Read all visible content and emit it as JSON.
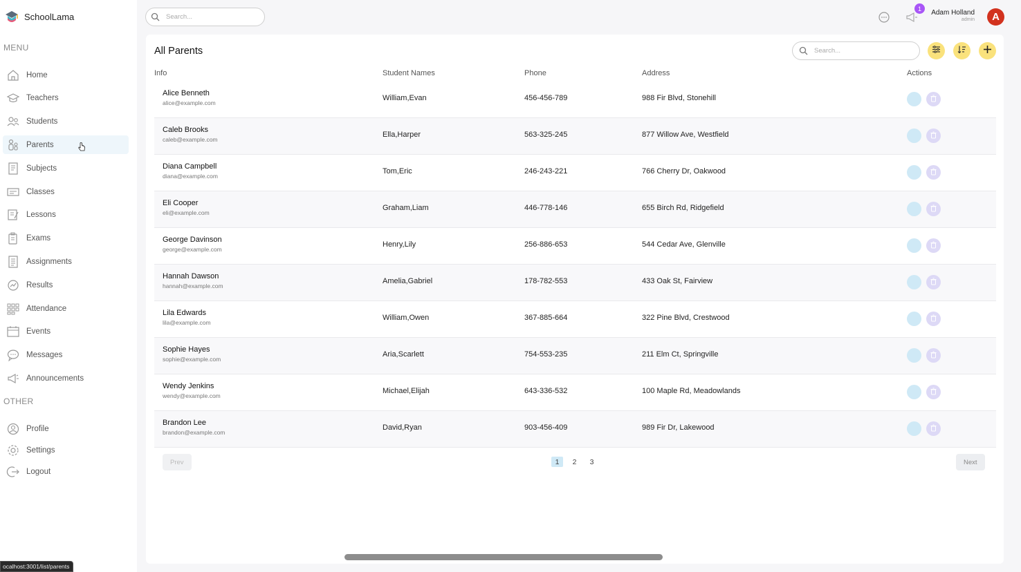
{
  "app": {
    "name": "SchoolLama"
  },
  "sidebar": {
    "menu_heading": "MENU",
    "other_heading": "OTHER",
    "menu_items": [
      {
        "label": "Home",
        "icon": "home-icon"
      },
      {
        "label": "Teachers",
        "icon": "teacher-icon"
      },
      {
        "label": "Students",
        "icon": "student-icon"
      },
      {
        "label": "Parents",
        "icon": "parent-icon",
        "active": true
      },
      {
        "label": "Subjects",
        "icon": "subject-icon"
      },
      {
        "label": "Classes",
        "icon": "class-icon"
      },
      {
        "label": "Lessons",
        "icon": "lesson-icon"
      },
      {
        "label": "Exams",
        "icon": "exam-icon"
      },
      {
        "label": "Assignments",
        "icon": "assignment-icon"
      },
      {
        "label": "Results",
        "icon": "result-icon"
      },
      {
        "label": "Attendance",
        "icon": "attendance-icon"
      },
      {
        "label": "Events",
        "icon": "calendar-icon"
      },
      {
        "label": "Messages",
        "icon": "message-icon"
      },
      {
        "label": "Announcements",
        "icon": "announcement-icon"
      }
    ],
    "other_items": [
      {
        "label": "Profile",
        "icon": "profile-icon"
      },
      {
        "label": "Settings",
        "icon": "settings-icon"
      },
      {
        "label": "Logout",
        "icon": "logout-icon"
      }
    ]
  },
  "topbar": {
    "search_placeholder": "Search...",
    "notification_count": "1",
    "user_name": "Adam Holland",
    "user_role": "admin",
    "avatar_letter": "A"
  },
  "panel": {
    "title": "All Parents",
    "search_placeholder": "Search...",
    "columns": [
      "Info",
      "Student Names",
      "Phone",
      "Address",
      "Actions"
    ],
    "rows": [
      {
        "name": "Alice Benneth",
        "email": "alice@example.com",
        "students": "William,Evan",
        "phone": "456-456-789",
        "address": "988 Fir Blvd, Stonehill"
      },
      {
        "name": "Caleb Brooks",
        "email": "caleb@example.com",
        "students": "Ella,Harper",
        "phone": "563-325-245",
        "address": "877 Willow Ave, Westfield"
      },
      {
        "name": "Diana Campbell",
        "email": "diana@example.com",
        "students": "Tom,Eric",
        "phone": "246-243-221",
        "address": "766 Cherry Dr, Oakwood"
      },
      {
        "name": "Eli Cooper",
        "email": "eli@example.com",
        "students": "Graham,Liam",
        "phone": "446-778-146",
        "address": "655 Birch Rd, Ridgefield"
      },
      {
        "name": "George Davinson",
        "email": "george@example.com",
        "students": "Henry,Lily",
        "phone": "256-886-653",
        "address": "544 Cedar Ave, Glenville"
      },
      {
        "name": "Hannah Dawson",
        "email": "hannah@example.com",
        "students": "Amelia,Gabriel",
        "phone": "178-782-553",
        "address": "433 Oak St, Fairview"
      },
      {
        "name": "Lila Edwards",
        "email": "lila@example.com",
        "students": "William,Owen",
        "phone": "367-885-664",
        "address": "322 Pine Blvd, Crestwood"
      },
      {
        "name": "Sophie Hayes",
        "email": "sophie@example.com",
        "students": "Aria,Scarlett",
        "phone": "754-553-235",
        "address": "211 Elm Ct, Springville"
      },
      {
        "name": "Wendy Jenkins",
        "email": "wendy@example.com",
        "students": "Michael,Elijah",
        "phone": "643-336-532",
        "address": "100 Maple Rd, Meadowlands"
      },
      {
        "name": "Brandon Lee",
        "email": "brandon@example.com",
        "students": "David,Ryan",
        "phone": "903-456-409",
        "address": "989 Fir Dr, Lakewood"
      }
    ],
    "pagination": {
      "prev_label": "Prev",
      "next_label": "Next",
      "pages": [
        "1",
        "2",
        "3"
      ],
      "current": "1"
    }
  },
  "status_bar": {
    "url": "ocalhost:3001/list/parents"
  },
  "colors": {
    "accent_yellow": "#fae27c",
    "sky_light": "#cfe9f6",
    "purple_light": "#ddd9f6",
    "badge_purple": "#a855f7",
    "avatar_red": "#d2321e"
  }
}
